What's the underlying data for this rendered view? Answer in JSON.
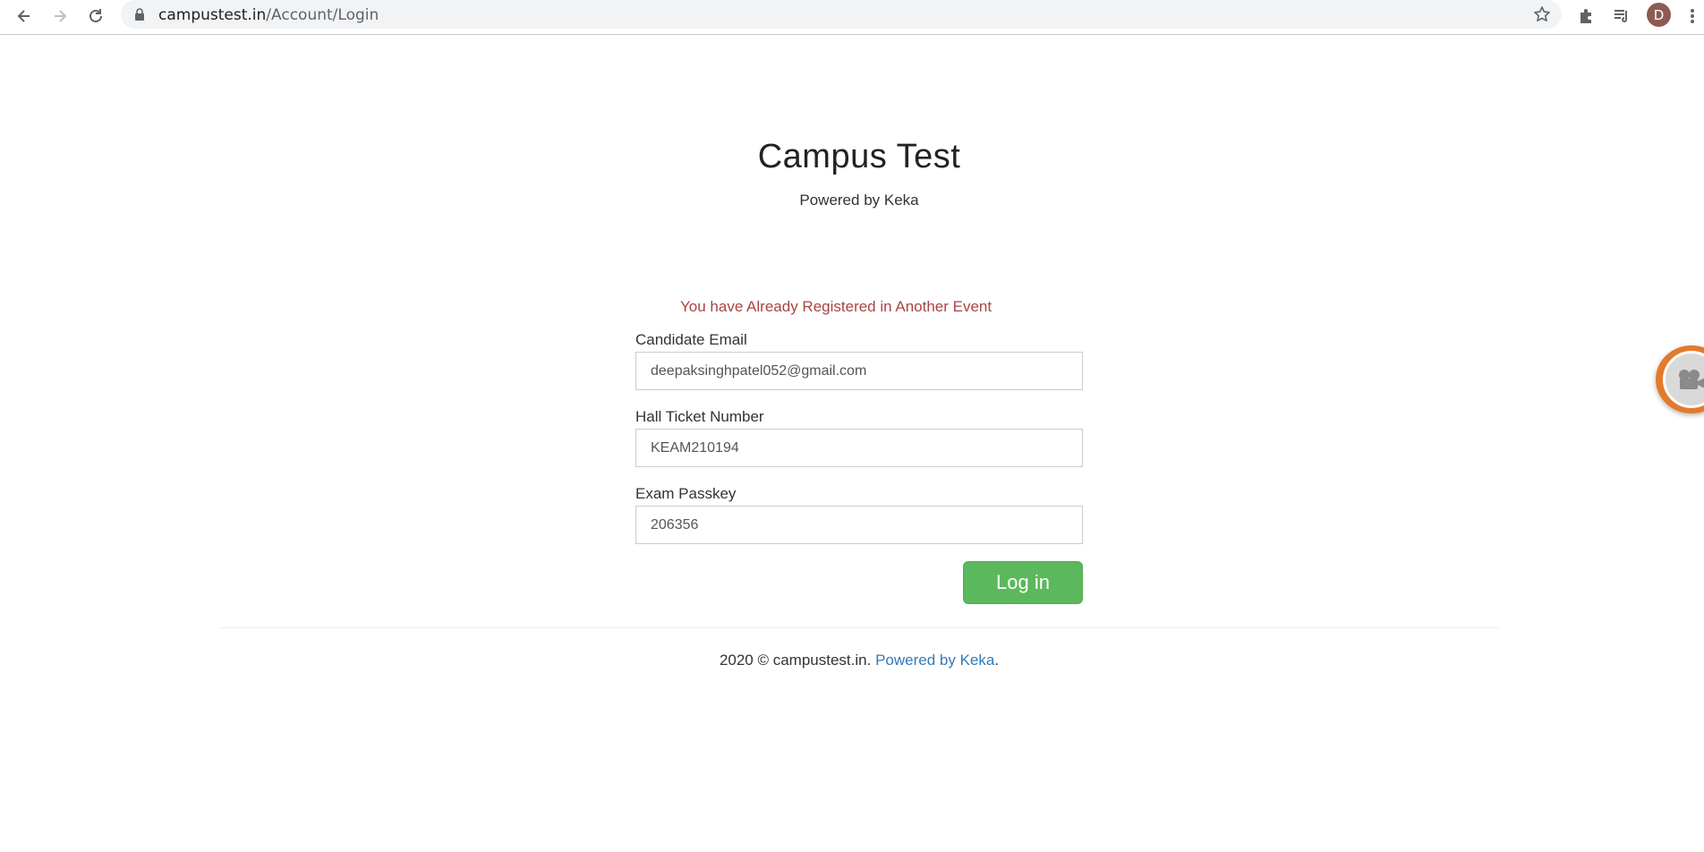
{
  "browser": {
    "url_host": "campustest.in",
    "url_path": "/Account/Login",
    "profile_initial": "D"
  },
  "header": {
    "title": "Campus Test",
    "subtitle": "Powered by Keka"
  },
  "form": {
    "error_message": "You have Already Registered in Another Event",
    "email_label": "Candidate Email",
    "email_value": "deepaksinghpatel052@gmail.com",
    "hall_ticket_label": "Hall Ticket Number",
    "hall_ticket_value": "KEAM210194",
    "passkey_label": "Exam Passkey",
    "passkey_value": "206356",
    "login_label": "Log in"
  },
  "footer": {
    "copyright": "2020 © campustest.in.",
    "powered_link": "Powered by Keka",
    "suffix": "."
  },
  "colors": {
    "error": "#a94442",
    "button": "#5cb85c",
    "link": "#337ab7"
  }
}
